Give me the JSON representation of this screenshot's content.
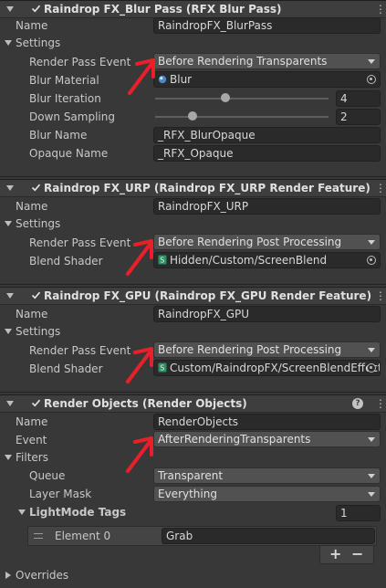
{
  "components": [
    {
      "title": "Raindrop FX_Blur Pass (RFX Blur Pass)",
      "name_label": "Name",
      "name_value": "RaindropFX_BlurPass",
      "settings_label": "Settings",
      "rows": [
        {
          "label": "Render Pass Event",
          "value": "Before Rendering Transparents"
        },
        {
          "label": "Blur Material",
          "value": "Blur"
        },
        {
          "label": "Blur Iteration",
          "value": "4",
          "slider_fraction": 0.51
        },
        {
          "label": "Down Sampling",
          "value": "2",
          "slider_fraction": 0.21
        },
        {
          "label": "Blur Name",
          "value": "_RFX_BlurOpaque"
        },
        {
          "label": "Opaque Name",
          "value": "_RFX_Opaque"
        }
      ]
    },
    {
      "title": "Raindrop FX_URP (Raindrop FX_URP Render Feature)",
      "name_label": "Name",
      "name_value": "RaindropFX_URP",
      "settings_label": "Settings",
      "rows": [
        {
          "label": "Render Pass Event",
          "value": "Before Rendering Post Processing"
        },
        {
          "label": "Blend Shader",
          "value": "Hidden/Custom/ScreenBlend"
        }
      ]
    },
    {
      "title": "Raindrop FX_GPU (Raindrop FX_GPU Render Feature)",
      "name_label": "Name",
      "name_value": "RaindropFX_GPU",
      "settings_label": "Settings",
      "rows": [
        {
          "label": "Render Pass Event",
          "value": "Before Rendering Post Processing"
        },
        {
          "label": "Blend Shader",
          "value": "Custom/RaindropFX/ScreenBlendEffect"
        }
      ]
    },
    {
      "title": "Render Objects (Render Objects)",
      "name_label": "Name",
      "name_value": "RenderObjects",
      "event_label": "Event",
      "event_value": "AfterRenderingTransparents",
      "filters_label": "Filters",
      "queue_label": "Queue",
      "queue_value": "Transparent",
      "layer_mask_label": "Layer Mask",
      "layer_mask_value": "Everything",
      "lightmode_label": "LightMode Tags",
      "lightmode_count": "1",
      "element_label": "Element 0",
      "element_value": "Grab",
      "plus": "+",
      "minus": "−",
      "overrides_label": "Overrides"
    }
  ],
  "icons": {
    "kebab": "⋮",
    "help": "?"
  },
  "colors": {
    "annotation_arrow": "#e8202a",
    "background": "#383838",
    "field": "#2a2a2a",
    "dropdown": "#515151"
  }
}
